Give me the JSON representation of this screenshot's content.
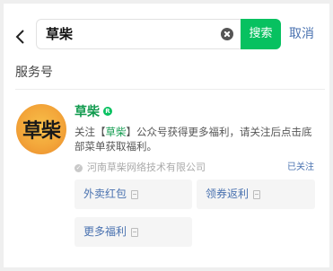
{
  "search": {
    "query": "草柴",
    "button_label": "搜索",
    "cancel_label": "取消"
  },
  "section": {
    "title": "服务号"
  },
  "result": {
    "logo_text": "草柴",
    "name": "草柴",
    "verified_badge": "R",
    "desc_prefix": "关注【",
    "desc_highlight": "草柴",
    "desc_suffix": "】公众号获得更多福利，请关注后点击底部菜单获取福利。",
    "company": "河南草柴网络技术有限公司",
    "follow_status": "已关注",
    "menu": [
      {
        "label": "外卖红包"
      },
      {
        "label": "领券返利"
      },
      {
        "label": "更多福利"
      }
    ]
  },
  "colors": {
    "brand_green": "#07c160",
    "name_green": "#129b4f",
    "link_blue": "#4a72b0"
  }
}
